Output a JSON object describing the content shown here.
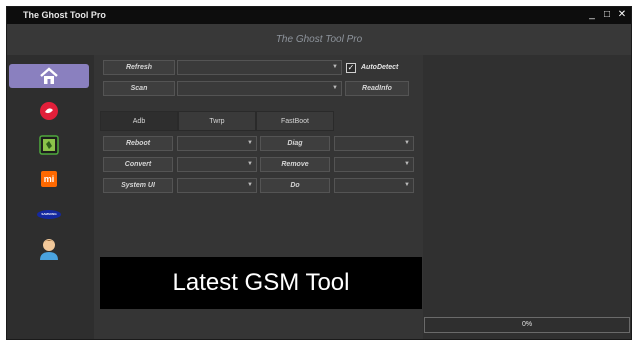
{
  "window": {
    "title": "The Ghost Tool Pro",
    "minimize": "_",
    "maximize": "□",
    "close": "✕"
  },
  "header": {
    "title": "The Ghost Tool Pro"
  },
  "sidebar": {
    "items": [
      {
        "name": "home",
        "icon": "home-icon",
        "active": true
      },
      {
        "name": "qualcomm",
        "icon": "qualcomm-icon"
      },
      {
        "name": "mediatek",
        "icon": "chip-icon"
      },
      {
        "name": "xiaomi",
        "icon": "xiaomi-icon",
        "text": "mi"
      },
      {
        "name": "samsung",
        "icon": "samsung-icon",
        "text": "SAMSUNG"
      },
      {
        "name": "user",
        "icon": "user-icon"
      }
    ]
  },
  "toolbar": {
    "refresh": "Refresh",
    "scan": "Scan",
    "autodetect": "AutoDetect",
    "autodetect_checked": true,
    "readinfo": "ReadInfo"
  },
  "tabs": [
    "Adb",
    "Twrp",
    "FastBoot"
  ],
  "actions": {
    "reboot": "Reboot",
    "convert": "Convert",
    "systemui": "System UI",
    "diag": "Diag",
    "remove": "Remove",
    "do": "Do"
  },
  "banner": "Latest GSM Tool",
  "progress": {
    "label": "0%",
    "value": 0
  },
  "colors": {
    "accent": "#8a80bf",
    "background": "#2b2b2b",
    "titlebar": "#0d0d0d"
  }
}
